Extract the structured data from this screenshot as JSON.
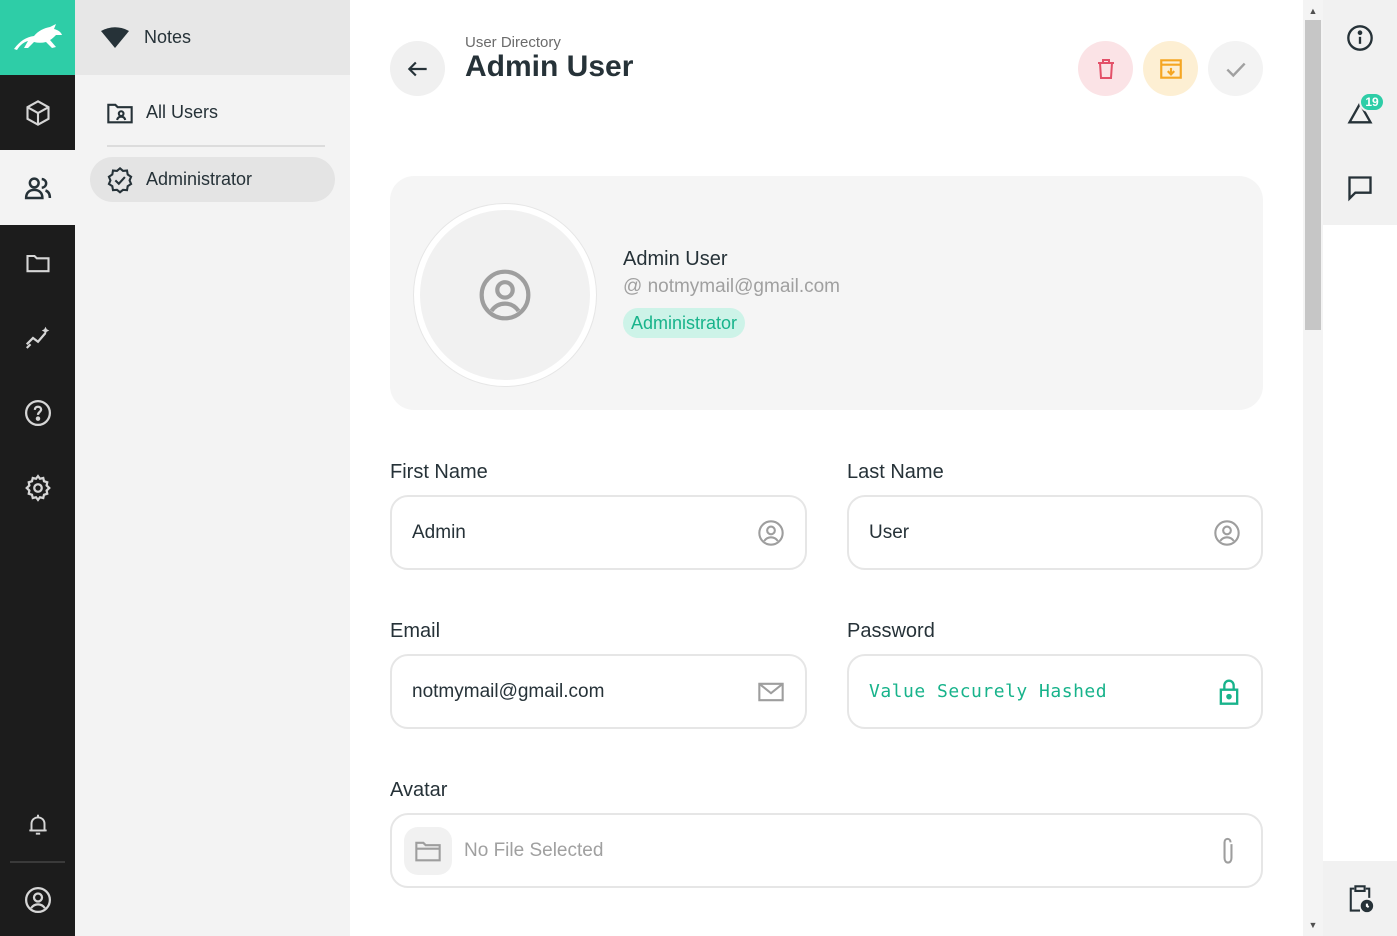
{
  "navigation": {
    "header_title": "Notes",
    "items": [
      {
        "label": "All Users"
      },
      {
        "label": "Administrator"
      }
    ]
  },
  "header": {
    "breadcrumb": "User Directory",
    "title": "Admin User"
  },
  "profile": {
    "name": "Admin User",
    "email": "@ notmymail@gmail.com",
    "role": "Administrator"
  },
  "form": {
    "first_name": {
      "label": "First Name",
      "value": "Admin"
    },
    "last_name": {
      "label": "Last Name",
      "value": "User"
    },
    "email": {
      "label": "Email",
      "value": "notmymail@gmail.com"
    },
    "password": {
      "label": "Password",
      "value": "Value Securely Hashed"
    },
    "avatar": {
      "label": "Avatar",
      "value": "No File Selected"
    }
  },
  "notifications": {
    "count": "19"
  },
  "colors": {
    "brand": "#2ecda7",
    "danger": "#e35169",
    "warning": "#f5a623",
    "success_text": "#18b38b"
  }
}
